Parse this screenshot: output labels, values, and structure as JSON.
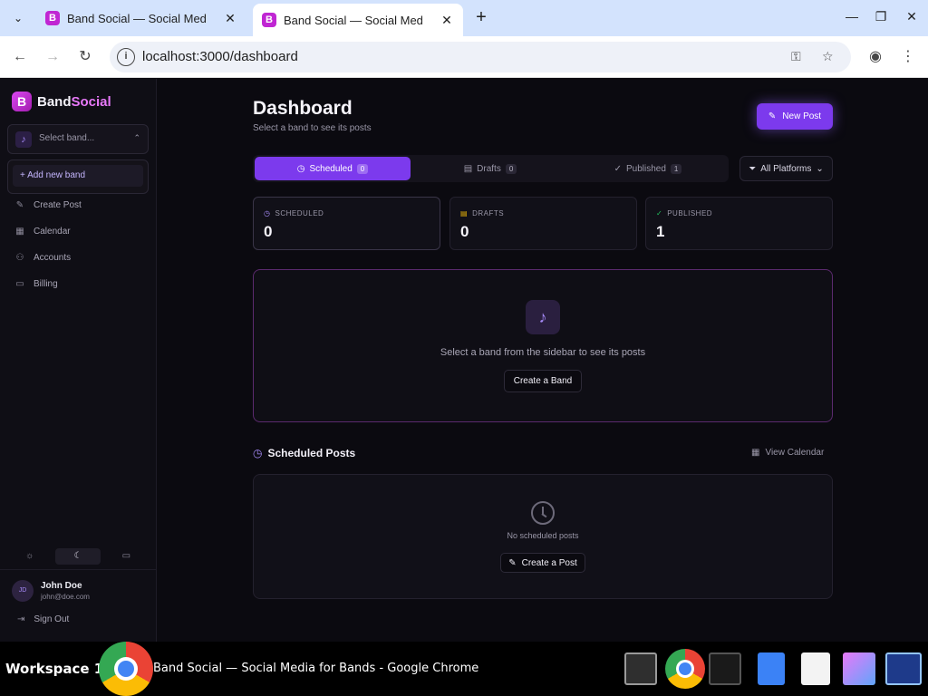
{
  "browser": {
    "tabs": [
      {
        "title": "Band Social — Social Med",
        "favicon": "B"
      },
      {
        "title": "Band Social — Social Med",
        "favicon": "B"
      }
    ],
    "url": "localhost:3000/dashboard"
  },
  "sidebar": {
    "brand_prefix": "Band",
    "brand_suffix": "Social",
    "band_select_placeholder": "Select band...",
    "add_band_label": "+ Add new band",
    "nav": [
      {
        "label": "Create Post",
        "icon": "edit-icon"
      },
      {
        "label": "Calendar",
        "icon": "calendar-icon"
      },
      {
        "label": "Accounts",
        "icon": "user-icon"
      },
      {
        "label": "Billing",
        "icon": "card-icon"
      }
    ],
    "user": {
      "initials": "JD",
      "name": "John Doe",
      "email": "john@doe.com"
    },
    "sign_out": "Sign Out"
  },
  "main": {
    "title": "Dashboard",
    "subtitle": "Select a band to see its posts",
    "new_post_label": "New Post",
    "tabs": [
      {
        "label": "Scheduled",
        "count": "0"
      },
      {
        "label": "Drafts",
        "count": "0"
      },
      {
        "label": "Published",
        "count": "1"
      }
    ],
    "platform_filter": "All Platforms",
    "stats": [
      {
        "label": "SCHEDULED",
        "value": "0"
      },
      {
        "label": "DRAFTS",
        "value": "0"
      },
      {
        "label": "PUBLISHED",
        "value": "1"
      }
    ],
    "empty_message": "Select a band from the sidebar to see its posts",
    "create_band_label": "Create a Band",
    "scheduled_title": "Scheduled Posts",
    "view_calendar": "View Calendar",
    "no_scheduled": "No scheduled posts",
    "create_post_label": "Create a Post"
  },
  "taskbar": {
    "workspace": "Workspace 1",
    "window_title": "Band Social — Social Media for Bands - Google Chrome"
  },
  "colors": {
    "accent": "#7c3aed",
    "brand": "#e879f9",
    "background": "#0b0a10"
  }
}
